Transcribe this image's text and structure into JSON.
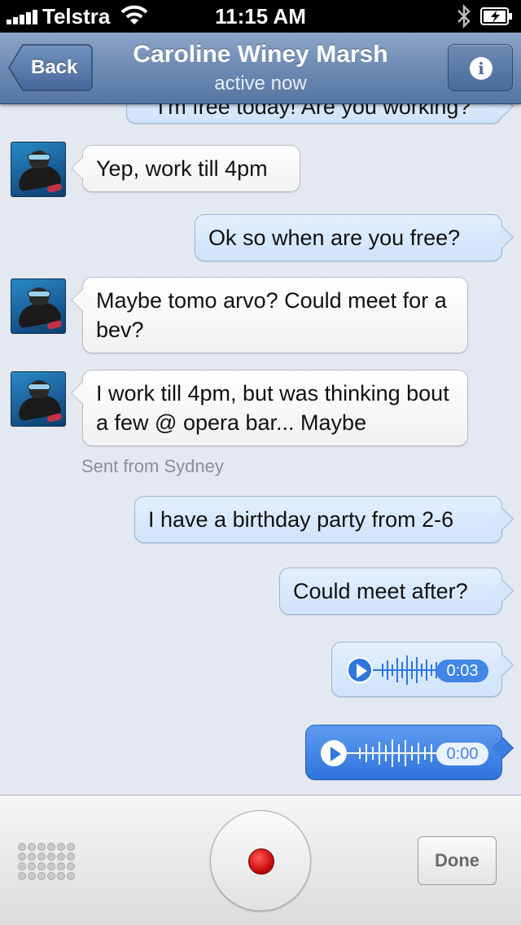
{
  "status_bar": {
    "carrier": "Telstra",
    "time": "11:15 AM"
  },
  "nav": {
    "back_label": "Back",
    "title": "Caroline Winey Marsh",
    "subtitle": "active now"
  },
  "messages": [
    {
      "text": "I'm free today! Are you working?",
      "direction": "out"
    },
    {
      "text": "Yep, work till 4pm",
      "direction": "in"
    },
    {
      "text": "Ok so when are you free?",
      "direction": "out"
    },
    {
      "text": "Maybe tomo arvo? Could meet for a bev?",
      "direction": "in"
    },
    {
      "text": "I work till 4pm, but was thinking bout a few @ opera bar... Maybe",
      "direction": "in"
    },
    {
      "text": "I have a birthday party from 2-6",
      "direction": "out"
    },
    {
      "text": "Could meet after?",
      "direction": "out"
    }
  ],
  "sent_from": "Sent from Sydney",
  "voice_messages": [
    {
      "duration": "0:03",
      "state": "recorded"
    },
    {
      "duration": "0:00",
      "state": "recording"
    }
  ],
  "toolbar": {
    "done_label": "Done"
  },
  "icons": [
    "signal-icon",
    "wifi-icon",
    "bluetooth-icon",
    "battery-icon",
    "back-arrow-icon",
    "info-icon",
    "play-icon",
    "waveform-icon",
    "keypad-icon",
    "record-icon"
  ],
  "colors": {
    "nav_bar": "#6d8ab3",
    "outgoing_bubble": "#d6e7fc",
    "incoming_bubble": "#ffffff",
    "active_voice": "#2e74dc",
    "record_red": "#c00000"
  }
}
